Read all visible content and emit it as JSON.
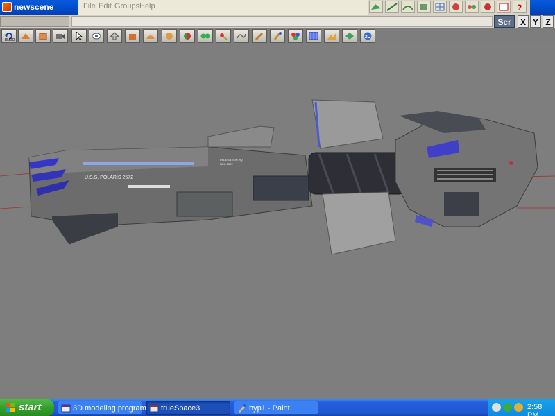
{
  "window": {
    "title": "newscene"
  },
  "menu": [
    "File",
    "Edit",
    "Groups",
    "Help"
  ],
  "view_buttons": {
    "scr": "Scr",
    "x": "X",
    "y": "Y",
    "z": "Z"
  },
  "toolbar": {
    "undo_label": "UNDO"
  },
  "ship": {
    "registry": "U.S.S. POLARIS 2572",
    "hull_text_1": "FEDERATION HQ",
    "hull_text_2": "NCC 2572"
  },
  "taskbar": {
    "start_label": "start",
    "tasks": [
      {
        "label": "3D modeling program..."
      },
      {
        "label": "trueSpace3"
      },
      {
        "label": "hyp1 - Paint"
      }
    ],
    "clock": "2:58 PM"
  },
  "colors": {
    "titlebar": "#0052d0",
    "viewport": "#7e7e7e",
    "taskbar": "#245edb",
    "start": "#34a02b"
  }
}
